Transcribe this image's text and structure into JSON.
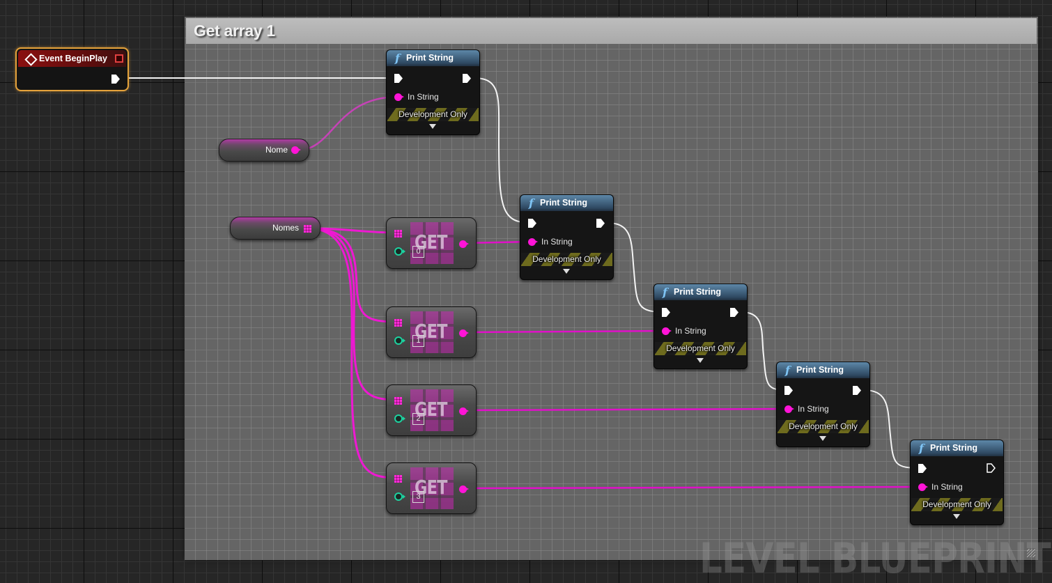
{
  "graph": {
    "watermark": "LEVEL BLUEPRINT",
    "comment": {
      "title": "Get array 1"
    },
    "event_node": {
      "title": "Event BeginPlay",
      "icon": "event-diamond-icon"
    },
    "variables": [
      {
        "name": "Nome",
        "type": "string",
        "pin_color": "#ff14d7"
      },
      {
        "name": "Nomes",
        "type": "string-array",
        "pin_color": "#ff2bd8"
      }
    ],
    "get_nodes": [
      {
        "label": "GET",
        "index": "0"
      },
      {
        "label": "GET",
        "index": "1"
      },
      {
        "label": "GET",
        "index": "2"
      },
      {
        "label": "GET",
        "index": "3"
      }
    ],
    "print_nodes": [
      {
        "title": "Print String",
        "in_label": "In String",
        "band": "Development Only",
        "exec_out_connected": true,
        "input_source": "Nome"
      },
      {
        "title": "Print String",
        "in_label": "In String",
        "band": "Development Only",
        "exec_out_connected": true,
        "input_source": "GET 0"
      },
      {
        "title": "Print String",
        "in_label": "In String",
        "band": "Development Only",
        "exec_out_connected": true,
        "input_source": "GET 1"
      },
      {
        "title": "Print String",
        "in_label": "In String",
        "band": "Development Only",
        "exec_out_connected": true,
        "input_source": "GET 2"
      },
      {
        "title": "Print String",
        "in_label": "In String",
        "band": "Development Only",
        "exec_out_connected": false,
        "input_source": "GET 3"
      }
    ],
    "colors": {
      "exec_wire": "#ffffff",
      "string_wire": "#e010c8",
      "event_header": "#8a1010",
      "event_outline": "#e5a23b",
      "function_header": "#4a7090",
      "integer_pin": "#1cd3a0",
      "dev_only_stripe": "#6e6b1e"
    }
  }
}
